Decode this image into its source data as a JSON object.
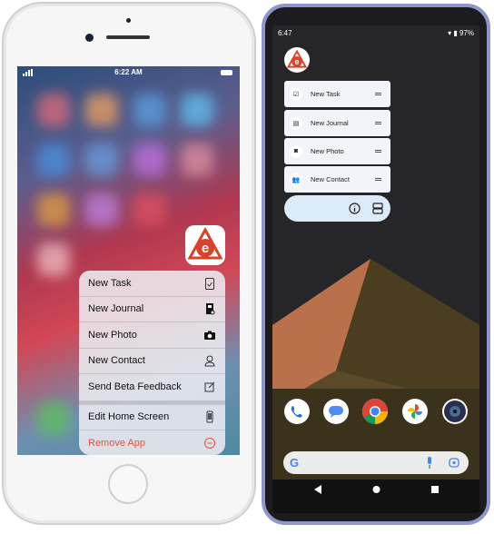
{
  "ios": {
    "status": {
      "time": "6:22 AM"
    },
    "menu": [
      {
        "label": "New Task",
        "icon": "clipboard-check-icon"
      },
      {
        "label": "New Journal",
        "icon": "journal-icon"
      },
      {
        "label": "New Photo",
        "icon": "camera-icon"
      },
      {
        "label": "New Contact",
        "icon": "person-icon"
      },
      {
        "label": "Send Beta Feedback",
        "icon": "compose-icon"
      }
    ],
    "system_menu": [
      {
        "label": "Edit Home Screen",
        "icon": "phone-icon"
      },
      {
        "label": "Remove App",
        "icon": "minus-circle-icon",
        "color": "#e8503f"
      }
    ]
  },
  "android": {
    "status": {
      "time": "6:47",
      "battery": "97%"
    },
    "shortcuts": [
      {
        "label": "New Task",
        "icon": "clipboard-check-icon"
      },
      {
        "label": "New Journal",
        "icon": "journal-icon"
      },
      {
        "label": "New Photo",
        "icon": "camera-icon"
      },
      {
        "label": "New Contact",
        "icon": "people-icon"
      }
    ],
    "dock": [
      "phone-icon",
      "messages-icon",
      "chrome-icon",
      "photos-icon",
      "camera-icon"
    ]
  },
  "colors": {
    "brand": "#d9432b",
    "remove": "#e8503f",
    "android_frame": "#8f96cc"
  }
}
